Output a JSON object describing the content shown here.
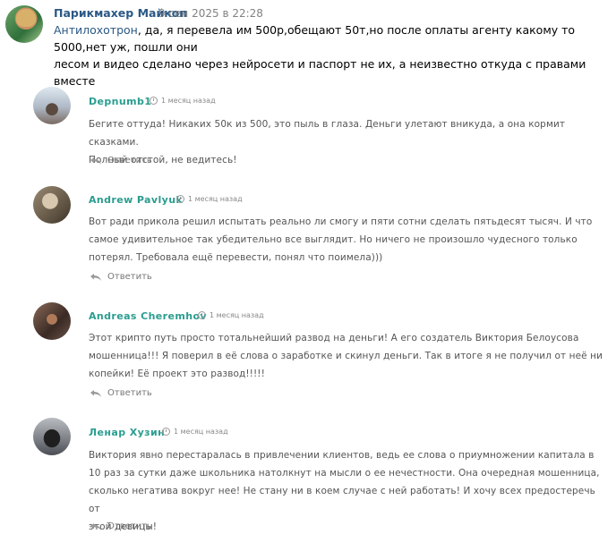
{
  "post": {
    "author": "Парикмахер Майкоп",
    "date": "9 сен 2025 в 22:28",
    "mention": "Антилохотрон",
    "text_line1_rest": ", да, я перевела им 500р,обещают 50т,но после оплаты агенту какому то 5000,нет уж, пошли они",
    "text_line2": "лесом и видео сделано через нейросети и паспорт не их, а неизвестно откуда с правами вместе"
  },
  "comments": [
    {
      "name": "Depnumb1",
      "time": "1 месяц назад",
      "lines": [
        "Бегите оттуда! Никаких 50к из 500, это пыль в глаза. Деньги улетают вникуда, а она кормит сказками.",
        "Полный отстой, не ведитесь!"
      ],
      "reply": "Ответить"
    },
    {
      "name": "Andrew Pavlyuk",
      "time": "1 месяц назад",
      "lines": [
        "Вот ради прикола решил испытать реально ли смогу и пяти сотни сделать пятьдесят тысяч. И что",
        "самое удивительное так убедительно все выглядит. Но ничего не произошло чудесного только",
        "потерял. Требовала ещё перевести, понял что поимела)))"
      ],
      "reply": "Ответить"
    },
    {
      "name": "Andreas Cheremhov",
      "time": "1 месяц назад",
      "lines": [
        "Этот крипто путь просто тотальнейший развод на деньги! А его создатель Виктория Белоусова",
        "мошенница!!! Я поверил в её слова о заработке и скинул деньги. Так в итоге я не получил от неё ни",
        "копейки! Её проект это развод!!!!!"
      ],
      "reply": "Ответить"
    },
    {
      "name": "Ленар Хузин",
      "time": "1 месяц назад",
      "lines": [
        "Виктория явно перестаралась в привлечении клиентов, ведь ее слова о приумножении капитала в",
        "10 раз за сутки даже школьника натолкнут на мысли о ее нечестности. Она очередная мошенница,",
        "сколько негатива вокруг нее! Не стану ни в коем случае с ней работать! И хочу всех предостеречь от",
        "этой девицы!"
      ],
      "reply": "Ответить"
    }
  ],
  "colors": {
    "link": "#2a5885",
    "comment_name": "#2a9d8f",
    "text_gray": "#555555"
  }
}
